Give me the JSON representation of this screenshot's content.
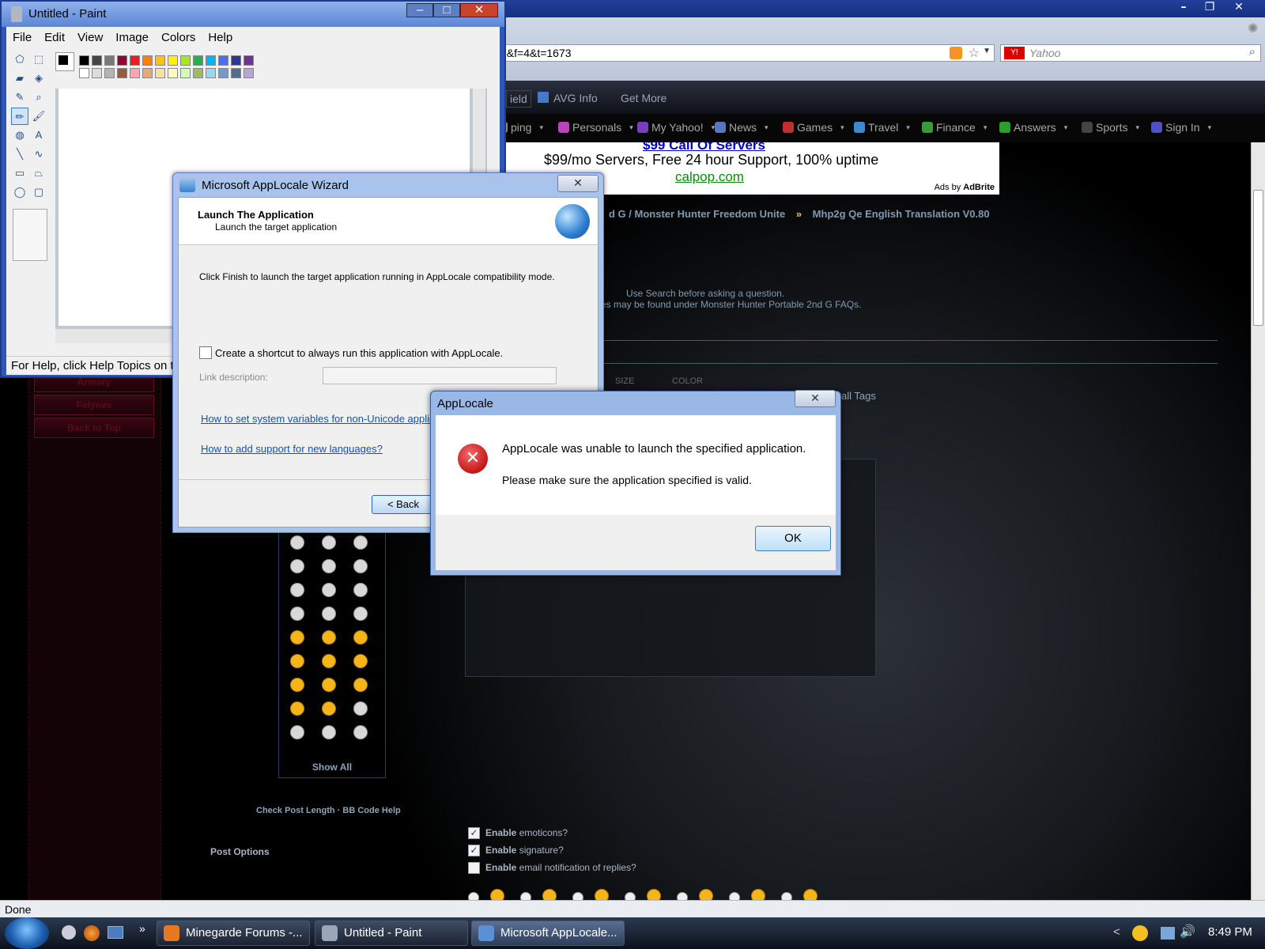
{
  "browser": {
    "url_fragment": "2&f=4&t=1673",
    "search_placeholder": "Yahoo",
    "toolbar1": {
      "shield": "ield",
      "avg": "AVG Info",
      "more": "Get More"
    },
    "toolbar2": [
      {
        "label": "ping",
        "color": "#888"
      },
      {
        "label": "Personals",
        "color": "#c040c0"
      },
      {
        "label": "My Yahoo!",
        "color": "#7a3dbb"
      },
      {
        "label": "News",
        "color": "#5a74c4"
      },
      {
        "label": "Games",
        "color": "#c03030"
      },
      {
        "label": "Travel",
        "color": "#3c8ad0"
      },
      {
        "label": "Finance",
        "color": "#3a9b3a"
      },
      {
        "label": "Answers",
        "color": "#2aa02a"
      },
      {
        "label": "Sports",
        "color": "#444"
      },
      {
        "label": "Sign In",
        "color": "#5050c0"
      }
    ],
    "status": "Done"
  },
  "ad": {
    "headline": "$99 Call Of Servers",
    "line": "$99/mo Servers, Free 24 hour Support, 100% uptime",
    "domain": "calpop.com",
    "ads_by": "Ads by",
    "brand": "AdBrite"
  },
  "forum": {
    "breadcrumb_a": "d G / Monster Hunter Freedom Unite",
    "breadcrumb_sep": "»",
    "breadcrumb_b": "Mhp2g Qe English Translation V0.80",
    "notice1": "Use Search before asking a question.",
    "notice2": "es may be found under Monster Hunter Portable 2nd G FAQs.",
    "size": "SIZE",
    "color": "COLOR",
    "all_tags": "all Tags",
    "sidebar": [
      "Armory",
      "Felynes",
      "Back to Top"
    ],
    "show_all": "Show All",
    "check_post": "Check Post Length",
    "sep": "·",
    "bbcode": "BB Code Help",
    "post_options": "Post Options",
    "options": [
      {
        "bold": "Enable",
        "text": "emoticons?",
        "checked": true
      },
      {
        "bold": "Enable",
        "text": "signature?",
        "checked": true
      },
      {
        "bold": "Enable",
        "text": "email notification of replies?",
        "checked": false
      }
    ]
  },
  "paint": {
    "title": "Untitled - Paint",
    "menu": [
      "File",
      "Edit",
      "View",
      "Image",
      "Colors",
      "Help"
    ],
    "status": "For Help, click Help Topics on the Help Menu.",
    "palette_top": [
      "#000000",
      "#464646",
      "#787878",
      "#990030",
      "#ed1c24",
      "#ff7e00",
      "#ffc20e",
      "#fff200",
      "#a8e61d",
      "#22b14c",
      "#00b7ef",
      "#4d6df3",
      "#2f3699",
      "#6f3198"
    ],
    "palette_bottom": [
      "#ffffff",
      "#dcdcdc",
      "#b4b4b4",
      "#9c5a3c",
      "#ffa3b1",
      "#e5aa7a",
      "#f5e49c",
      "#fff9bd",
      "#d3f9bc",
      "#9dbb61",
      "#99d9ea",
      "#709ad1",
      "#546d8e",
      "#b5a5d5"
    ]
  },
  "wizard": {
    "title": "Microsoft AppLocale Wizard",
    "heading": "Launch The Application",
    "subheading": "Launch the target application",
    "body": "Click Finish to launch the target application running in AppLocale compatibility mode.",
    "checkbox_label": "Create a shortcut to always run this application with AppLocale.",
    "link_desc_label": "Link description:",
    "link1": "How to set system variables for non-Unicode applications?",
    "link2": "How to add support for new languages?",
    "back": "< Back"
  },
  "error": {
    "title": "AppLocale",
    "line1": "AppLocale was unable to launch the specified application.",
    "line2": "Please make sure the application specified is valid.",
    "ok": "OK"
  },
  "taskbar": {
    "items": [
      {
        "label": "Minegarde Forums -...",
        "color": "#e87722"
      },
      {
        "label": "Untitled - Paint",
        "color": "#9aa7b8"
      },
      {
        "label": "Microsoft AppLocale...",
        "color": "#5b8fd6"
      }
    ],
    "clock": "8:49 PM",
    "chevron": "»",
    "tray_arrow": "<"
  }
}
